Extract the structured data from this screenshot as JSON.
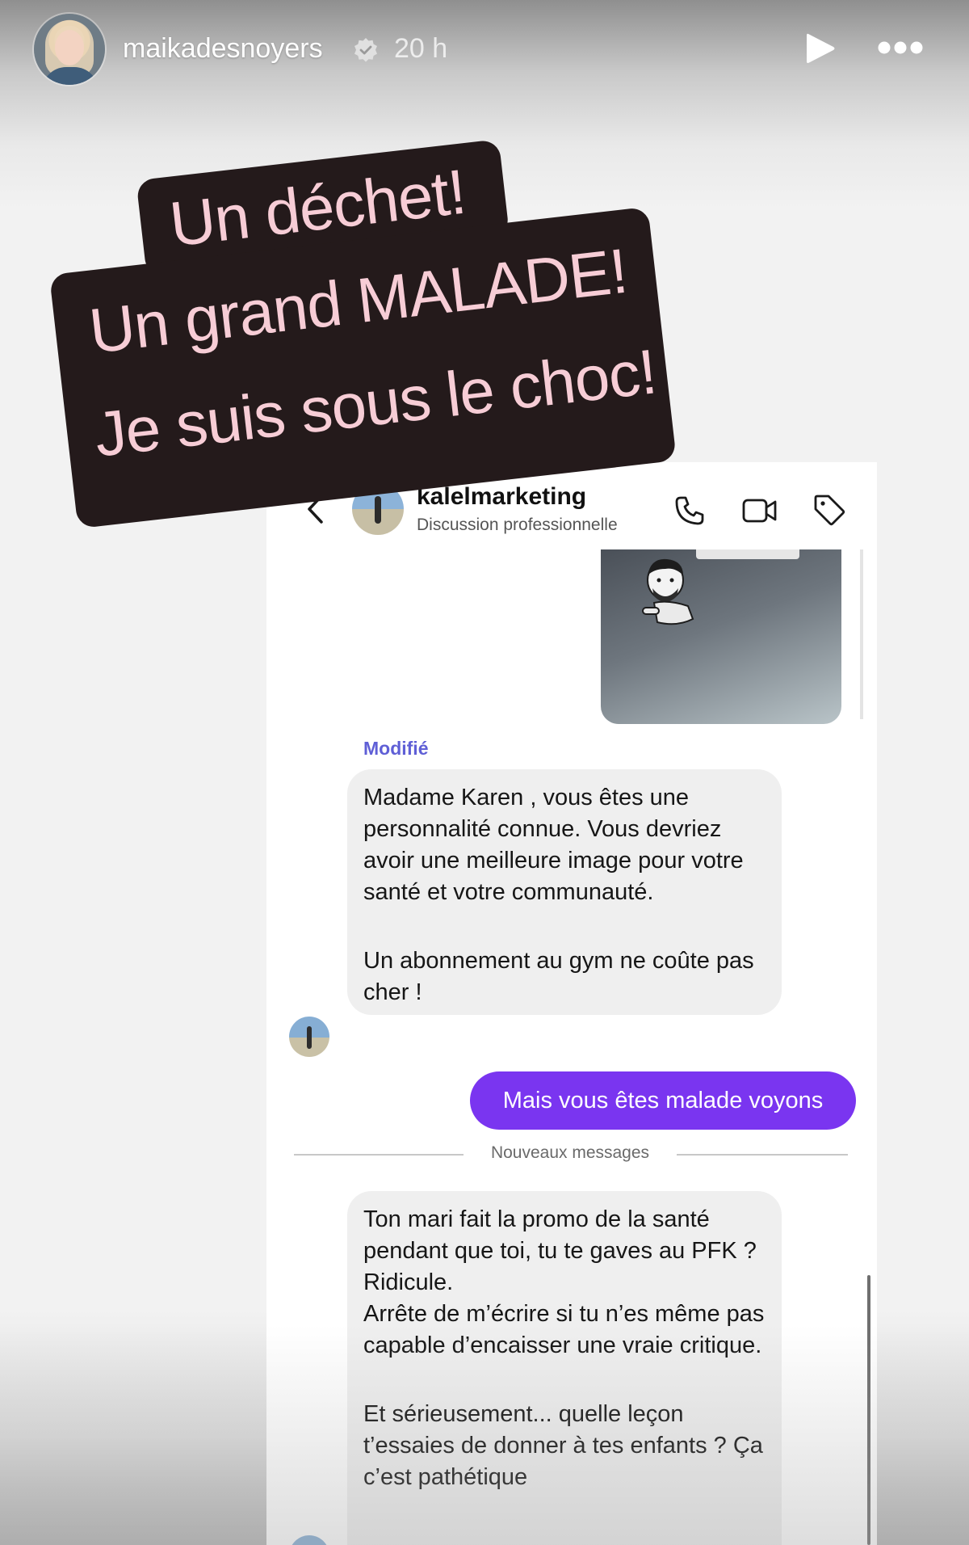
{
  "story": {
    "username": "maikadesnoyers",
    "time": "20 h",
    "icons": [
      "verified-badge-icon",
      "play-icon",
      "more-options-icon"
    ]
  },
  "stickers": {
    "line1": "Un déchet!",
    "line2": "Un grand MALADE!",
    "line3": "Je suis sous le choc!"
  },
  "dm": {
    "contact_name": "kalelmarketing",
    "subtitle": "Discussion professionnelle",
    "header_icons": [
      "back-arrow-icon",
      "phone-icon",
      "video-camera-icon",
      "tag-icon"
    ],
    "edited_label": "Modifié",
    "message1": {
      "para1": "Madame Karen , vous êtes une personnalité connue. Vous devriez avoir une meilleure image pour votre santé et votre communauté.",
      "para2": "Un abonnement au gym ne coûte pas cher !"
    },
    "sent_message": "Mais vous êtes malade voyons",
    "divider_label": "Nouveaux messages",
    "message2": {
      "para1": "Ton mari fait la promo de la santé pendant que toi, tu te gaves au PFK ? Ridicule.",
      "para2": "Arrête de m’écrire si tu n’es même pas capable d’encaisser une vraie critique.",
      "para3": "Et sérieusement... quelle leçon t’essaies de donner à tes enfants ? Ça c’est pathétique"
    },
    "colors": {
      "sent_bubble": "#7a35f0",
      "edited_label": "#5f5fd6",
      "sticker_background": "#241a1b",
      "sticker_text": "#f7cdd6"
    }
  }
}
